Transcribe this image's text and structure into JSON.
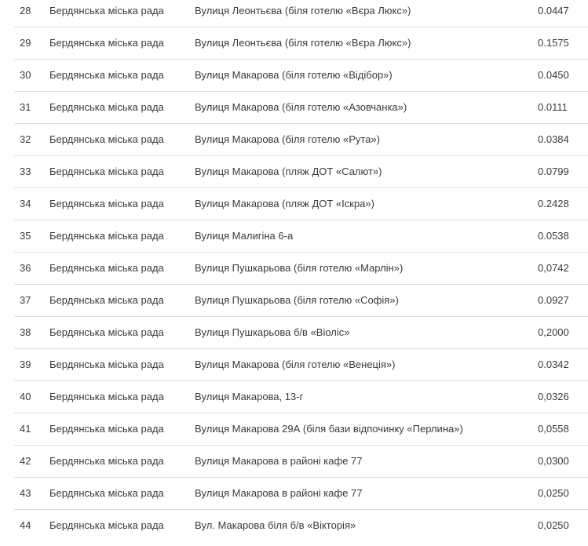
{
  "table": {
    "rows": [
      {
        "num": "28",
        "council": "Бердянська міська рада",
        "address": "Вулиця Леонтьєва (біля готелю «Вєра Люкс»)",
        "area": "0.0447"
      },
      {
        "num": "29",
        "council": "Бердянська міська рада",
        "address": "Вулиця Леонтьєва (біля готелю «Вєра Люкс»)",
        "area": "0.1575"
      },
      {
        "num": "30",
        "council": "Бердянська міська рада",
        "address": "Вулиця Макарова (біля готелю «Відібор»)",
        "area": "0.0450"
      },
      {
        "num": "31",
        "council": "Бердянська міська рада",
        "address": "Вулиця Макарова (біля готелю «Азовчанка»)",
        "area": "0.0111"
      },
      {
        "num": "32",
        "council": "Бердянська міська рада",
        "address": "Вулиця Макарова (біля готелю «Рута»)",
        "area": "0.0384"
      },
      {
        "num": "33",
        "council": "Бердянська міська рада",
        "address": "Вулиця Макарова (пляж ДОТ «Салют»)",
        "area": "0.0799"
      },
      {
        "num": "34",
        "council": "Бердянська міська рада",
        "address": "Вулиця Макарова (пляж ДОТ «Іскра»)",
        "area": "0.2428"
      },
      {
        "num": "35",
        "council": "Бердянська міська рада",
        "address": "Вулиця Малигіна 6-а",
        "area": "0.0538"
      },
      {
        "num": "36",
        "council": "Бердянська міська рада",
        "address": "Вулиця Пушкарьова (біля готелю «Марлін»)",
        "area": "0,0742"
      },
      {
        "num": "37",
        "council": "Бердянська міська рада",
        "address": "Вулиця Пушкарьова (біля готелю «Софія»)",
        "area": "0.0927"
      },
      {
        "num": "38",
        "council": "Бердянська міська рада",
        "address": "Вулиця Пушкарьова б/в «Віоліс»",
        "area": "0,2000"
      },
      {
        "num": "39",
        "council": "Бердянська міська рада",
        "address": "Вулиця Макарова (біля готелю «Венеція»)",
        "area": "0.0342"
      },
      {
        "num": "40",
        "council": "Бердянська міська рада",
        "address": "Вулиця Макарова, 13-г",
        "area": "0,0326"
      },
      {
        "num": "41",
        "council": "Бердянська міська рада",
        "address": "Вулиця Макарова 29А (біля бази відпочинку «Перлина»)",
        "area": "0,0558"
      },
      {
        "num": "42",
        "council": "Бердянська міська рада",
        "address": "Вулиця Макарова в районі кафе 77",
        "area": "0,0300"
      },
      {
        "num": "43",
        "council": "Бердянська міська рада",
        "address": "Вулиця Макарова в районі кафе 77",
        "area": "0,0250"
      },
      {
        "num": "44",
        "council": "Бердянська міська рада",
        "address": "Вул. Макарова біля б/в «Вікторія»",
        "area": "0,0250"
      }
    ]
  }
}
